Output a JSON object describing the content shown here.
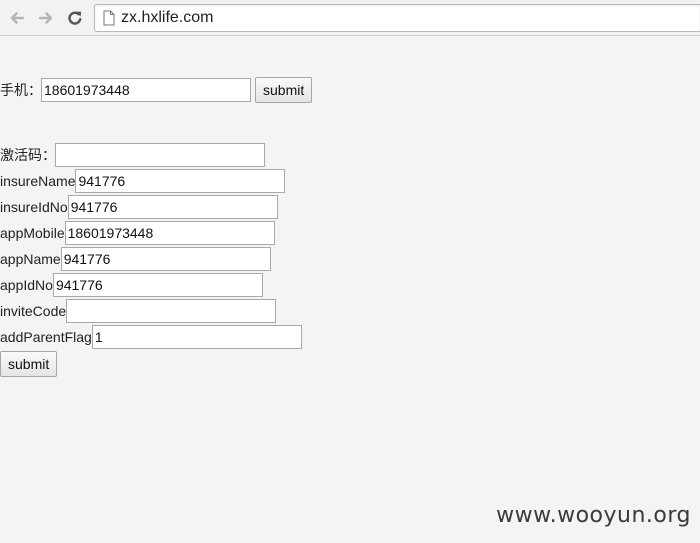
{
  "browser": {
    "url": "zx.hxlife.com",
    "icons": {
      "back": "back-arrow-icon",
      "forward": "forward-arrow-icon",
      "reload": "reload-icon",
      "page": "page-icon"
    }
  },
  "phone_form": {
    "label": "手机：",
    "phone_value": "18601973448",
    "submit_label": "submit"
  },
  "activation_form": {
    "activation_label": "激活码：",
    "activation_value": "",
    "fields": [
      {
        "label": "insureName",
        "value": "941776"
      },
      {
        "label": "insureIdNo",
        "value": "941776"
      },
      {
        "label": "appMobile",
        "value": "18601973448"
      },
      {
        "label": "appName",
        "value": "941776"
      },
      {
        "label": "appIdNo",
        "value": "941776"
      },
      {
        "label": "inviteCode",
        "value": ""
      },
      {
        "label": "addParentFlag",
        "value": "1"
      }
    ],
    "submit_label": "submit"
  },
  "watermark": "www.wooyun.org"
}
